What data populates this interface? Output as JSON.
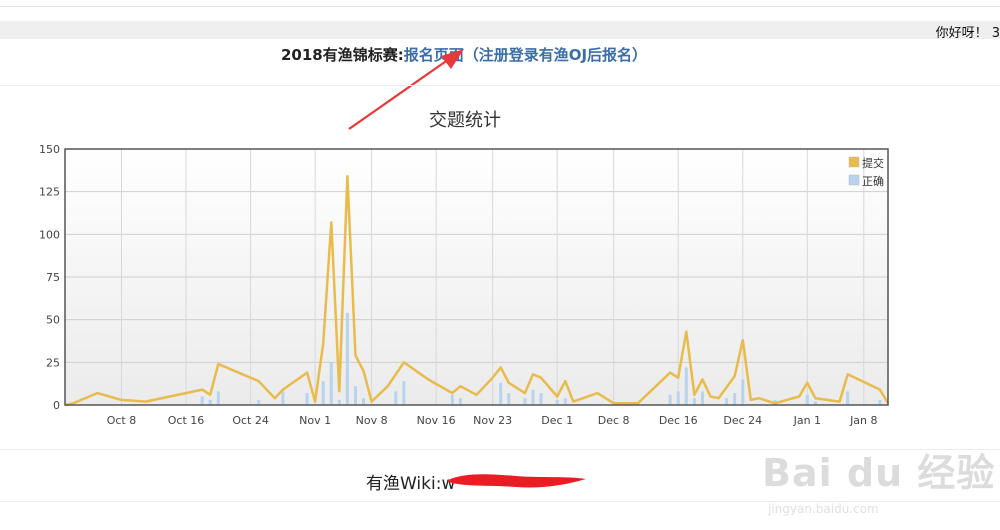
{
  "header": {
    "greeting": "你好呀！ 3"
  },
  "notice": {
    "prefix": "2018有渔锦标赛:",
    "link_label": "报名页面（注册登录有渔OJ后报名）"
  },
  "chart_data": {
    "type": "bar+line",
    "title": "交题统计",
    "xlabel": "",
    "ylabel": "",
    "ylim": [
      0,
      150
    ],
    "y_ticks": [
      "0",
      "25",
      "50",
      "75",
      "100",
      "125",
      "150"
    ],
    "x_tick_labels": [
      "Oct 8",
      "Oct 16",
      "Oct 24",
      "Nov 1",
      "Nov 8",
      "Nov 16",
      "Nov 23",
      "Dec 1",
      "Dec 8",
      "Dec 16",
      "Dec 24",
      "Jan 1",
      "Jan 8"
    ],
    "x_range": [
      "2018-10-01",
      "2019-01-11"
    ],
    "grid": true,
    "legend_position": "top-right",
    "colors": {
      "submit": "#e8bb4c",
      "correct": "#b7d3ee"
    },
    "series": [
      {
        "name": "提交",
        "type": "line",
        "points": [
          [
            "2018-10-01",
            0
          ],
          [
            "2018-10-02",
            1
          ],
          [
            "2018-10-05",
            7
          ],
          [
            "2018-10-08",
            3
          ],
          [
            "2018-10-11",
            2
          ],
          [
            "2018-10-14",
            5
          ],
          [
            "2018-10-18",
            9
          ],
          [
            "2018-10-19",
            6
          ],
          [
            "2018-10-20",
            24
          ],
          [
            "2018-10-23",
            18
          ],
          [
            "2018-10-25",
            14
          ],
          [
            "2018-10-27",
            4
          ],
          [
            "2018-10-28",
            9
          ],
          [
            "2018-10-31",
            19
          ],
          [
            "2018-11-01",
            2
          ],
          [
            "2018-11-02",
            36
          ],
          [
            "2018-11-03",
            107
          ],
          [
            "2018-11-04",
            8
          ],
          [
            "2018-11-05",
            134
          ],
          [
            "2018-11-06",
            29
          ],
          [
            "2018-11-07",
            20
          ],
          [
            "2018-11-08",
            2
          ],
          [
            "2018-11-10",
            11
          ],
          [
            "2018-11-12",
            25
          ],
          [
            "2018-11-15",
            15
          ],
          [
            "2018-11-18",
            7
          ],
          [
            "2018-11-19",
            11
          ],
          [
            "2018-11-21",
            6
          ],
          [
            "2018-11-23",
            16
          ],
          [
            "2018-11-24",
            22
          ],
          [
            "2018-11-25",
            13
          ],
          [
            "2018-11-27",
            7
          ],
          [
            "2018-11-28",
            18
          ],
          [
            "2018-11-29",
            16
          ],
          [
            "2018-12-01",
            5
          ],
          [
            "2018-12-02",
            14
          ],
          [
            "2018-12-03",
            2
          ],
          [
            "2018-12-06",
            7
          ],
          [
            "2018-12-08",
            1
          ],
          [
            "2018-12-11",
            1
          ],
          [
            "2018-12-15",
            19
          ],
          [
            "2018-12-16",
            16
          ],
          [
            "2018-12-17",
            43
          ],
          [
            "2018-12-18",
            6
          ],
          [
            "2018-12-19",
            15
          ],
          [
            "2018-12-20",
            5
          ],
          [
            "2018-12-21",
            4
          ],
          [
            "2018-12-23",
            17
          ],
          [
            "2018-12-24",
            38
          ],
          [
            "2018-12-25",
            3
          ],
          [
            "2018-12-26",
            4
          ],
          [
            "2018-12-28",
            1
          ],
          [
            "2018-12-31",
            5
          ],
          [
            "2019-01-01",
            13
          ],
          [
            "2019-01-02",
            4
          ],
          [
            "2019-01-05",
            2
          ],
          [
            "2019-01-06",
            18
          ],
          [
            "2019-01-10",
            9
          ],
          [
            "2019-01-11",
            1
          ]
        ]
      },
      {
        "name": "正确",
        "type": "bar",
        "points": [
          [
            "2018-10-18",
            5
          ],
          [
            "2018-10-19",
            3
          ],
          [
            "2018-10-20",
            8
          ],
          [
            "2018-10-25",
            3
          ],
          [
            "2018-10-28",
            8
          ],
          [
            "2018-10-31",
            7
          ],
          [
            "2018-11-02",
            14
          ],
          [
            "2018-11-03",
            25
          ],
          [
            "2018-11-04",
            3
          ],
          [
            "2018-11-05",
            54
          ],
          [
            "2018-11-06",
            11
          ],
          [
            "2018-11-07",
            4
          ],
          [
            "2018-11-11",
            8
          ],
          [
            "2018-11-12",
            14
          ],
          [
            "2018-11-18",
            6
          ],
          [
            "2018-11-19",
            4
          ],
          [
            "2018-11-24",
            13
          ],
          [
            "2018-11-25",
            7
          ],
          [
            "2018-11-27",
            4
          ],
          [
            "2018-11-28",
            9
          ],
          [
            "2018-11-29",
            7
          ],
          [
            "2018-12-01",
            3
          ],
          [
            "2018-12-02",
            4
          ],
          [
            "2018-12-15",
            6
          ],
          [
            "2018-12-16",
            8
          ],
          [
            "2018-12-17",
            22
          ],
          [
            "2018-12-18",
            4
          ],
          [
            "2018-12-19",
            8
          ],
          [
            "2018-12-22",
            4
          ],
          [
            "2018-12-23",
            7
          ],
          [
            "2018-12-24",
            15
          ],
          [
            "2018-12-28",
            3
          ],
          [
            "2019-01-01",
            6
          ],
          [
            "2019-01-02",
            2
          ],
          [
            "2019-01-06",
            8
          ],
          [
            "2019-01-10",
            3
          ]
        ]
      }
    ]
  },
  "footer": {
    "wiki_label": "有渔Wiki:w"
  },
  "watermark": {
    "logo": "Bai du 经验",
    "url": "jingyan.baidu.com"
  }
}
